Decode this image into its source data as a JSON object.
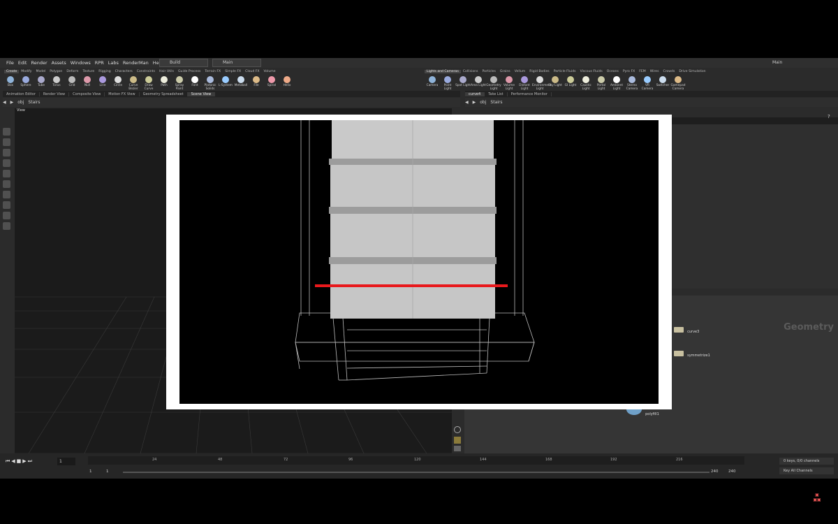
{
  "menu": [
    "File",
    "Edit",
    "Render",
    "Assets",
    "Windows",
    "RPR",
    "Labs",
    "RenderMan",
    "Help"
  ],
  "desktop": {
    "build_label": "Build",
    "main_label": "Main",
    "right_main_label": "Main"
  },
  "shelf_tabs_left": [
    "Create",
    "Modify",
    "Model",
    "Polygon",
    "Deform",
    "Texture",
    "Rigging",
    "Characters",
    "Constraints",
    "Hair Utils",
    "Guide Process",
    "Terrain FX",
    "Simple FX",
    "Cloud FX",
    "Volume"
  ],
  "shelf_tabs_right": [
    "Lights and Cameras",
    "Collisions",
    "Particles",
    "Grains",
    "Vellum",
    "Rigid Bodies",
    "Particle Fluids",
    "Viscous Fluids",
    "Oceans",
    "Pyro FX",
    "FEM",
    "Wires",
    "Crowds",
    "Drive Simulation"
  ],
  "tools_left": [
    "Box",
    "Sphere",
    "Tube",
    "Torus",
    "Grid",
    "Null",
    "Line",
    "Circle",
    "Curve Bezier",
    "Draw Curve",
    "Path",
    "Spray Paint",
    "Font",
    "Platonic Solids",
    "L-System",
    "Metaball",
    "File",
    "Spiral",
    "Helix"
  ],
  "tools_right": [
    "Camera",
    "Point Light",
    "Spot Light",
    "Area Light",
    "Geometry Light",
    "Volume Light",
    "Distant Light",
    "Environment Light",
    "Sky Light",
    "GI Light",
    "Caustic Light",
    "Portal Light",
    "Ambient Light",
    "Stereo Camera",
    "VR Camera",
    "Switcher",
    "Gamepad Camera"
  ],
  "pane_tabs_left": [
    "Animation Editor",
    "Render View",
    "Composite View",
    "Motion FX View",
    "Geometry Spreadsheet",
    "Scene View"
  ],
  "pane_tabs_right": [
    "curve4",
    "Take List",
    "Performance Monitor"
  ],
  "path_left": {
    "root": "obj",
    "node": "Stairs"
  },
  "path_right": {
    "root": "obj",
    "node": "Stairs"
  },
  "viewport": {
    "label": "View"
  },
  "network": {
    "context_label": "Geometry",
    "nodes": [
      "curve3",
      "symmetrize1",
      "polyfill1"
    ]
  },
  "timeline": {
    "frame": "1",
    "start": "1",
    "start2": "1",
    "end": "240",
    "end2": "240",
    "ticks": [
      "24",
      "48",
      "72",
      "96",
      "120",
      "144",
      "168",
      "192",
      "216"
    ],
    "keys_label": "0 keys, 0/0 channels",
    "key_all_label": "Key All Channels"
  },
  "colors": {
    "accent_red": "#e8191c",
    "stair_fill": "#c8c8c8"
  }
}
